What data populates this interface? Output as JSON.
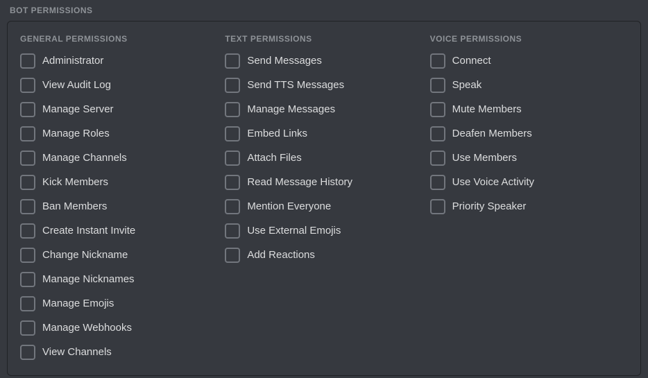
{
  "section_title": "BOT PERMISSIONS",
  "columns": {
    "general": {
      "header": "GENERAL PERMISSIONS",
      "items": [
        {
          "label": "Administrator",
          "checked": false
        },
        {
          "label": "View Audit Log",
          "checked": false
        },
        {
          "label": "Manage Server",
          "checked": false
        },
        {
          "label": "Manage Roles",
          "checked": false
        },
        {
          "label": "Manage Channels",
          "checked": false
        },
        {
          "label": "Kick Members",
          "checked": false
        },
        {
          "label": "Ban Members",
          "checked": false
        },
        {
          "label": "Create Instant Invite",
          "checked": false
        },
        {
          "label": "Change Nickname",
          "checked": false
        },
        {
          "label": "Manage Nicknames",
          "checked": false
        },
        {
          "label": "Manage Emojis",
          "checked": false
        },
        {
          "label": "Manage Webhooks",
          "checked": false
        },
        {
          "label": "View Channels",
          "checked": false
        }
      ]
    },
    "text": {
      "header": "TEXT PERMISSIONS",
      "items": [
        {
          "label": "Send Messages",
          "checked": false
        },
        {
          "label": "Send TTS Messages",
          "checked": false
        },
        {
          "label": "Manage Messages",
          "checked": false
        },
        {
          "label": "Embed Links",
          "checked": false
        },
        {
          "label": "Attach Files",
          "checked": false
        },
        {
          "label": "Read Message History",
          "checked": false
        },
        {
          "label": "Mention Everyone",
          "checked": false
        },
        {
          "label": "Use External Emojis",
          "checked": false
        },
        {
          "label": "Add Reactions",
          "checked": false
        }
      ]
    },
    "voice": {
      "header": "VOICE PERMISSIONS",
      "items": [
        {
          "label": "Connect",
          "checked": false
        },
        {
          "label": "Speak",
          "checked": false
        },
        {
          "label": "Mute Members",
          "checked": false
        },
        {
          "label": "Deafen Members",
          "checked": false
        },
        {
          "label": "Use Members",
          "checked": false
        },
        {
          "label": "Use Voice Activity",
          "checked": false
        },
        {
          "label": "Priority Speaker",
          "checked": false
        }
      ]
    }
  }
}
